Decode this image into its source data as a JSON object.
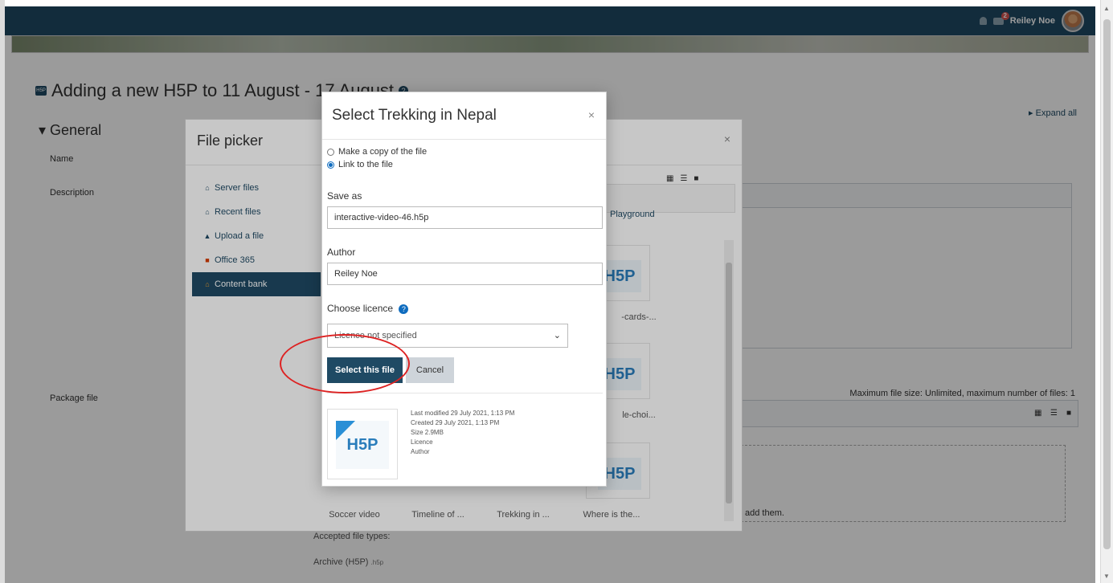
{
  "navbar": {
    "notifications_badge": "2",
    "user_name": "Reiley Noe"
  },
  "page": {
    "title": "Adding a new H5P to 11 August - 17 August",
    "expand_all": "▸ Expand all",
    "general_legend": "General",
    "labels": {
      "name": "Name",
      "description": "Description",
      "package_file": "Package file"
    },
    "max_file_size": "Maximum file size: Unlimited, maximum number of files: 1",
    "drop_text": "add them.",
    "accepted_types": "Accepted file types:",
    "archive": "Archive (H5P)",
    "archive_ext": ".h5p"
  },
  "file_picker": {
    "title": "File picker",
    "close": "×",
    "repositories": [
      {
        "label": "Server files",
        "icon": "server-icon"
      },
      {
        "label": "Recent files",
        "icon": "recent-icon"
      },
      {
        "label": "Upload a file",
        "icon": "upload-icon"
      },
      {
        "label": "Office 365",
        "icon": "office-icon"
      },
      {
        "label": "Content bank",
        "icon": "content-bank-icon"
      }
    ],
    "path_label": "Playground",
    "tiles": [
      {
        "label": "-cards-..."
      },
      {
        "label": "le-choi..."
      },
      {
        "label": ""
      }
    ],
    "bottom_labels": [
      "Soccer video",
      "Timeline of ...",
      "Trekking in ...",
      "Where is the..."
    ]
  },
  "select_dialog": {
    "title": "Select Trekking in Nepal",
    "close": "×",
    "options": {
      "copy": "Make a copy of the file",
      "link": "Link to the file"
    },
    "selected_option": "link",
    "save_as_label": "Save as",
    "save_as_value": "interactive-video-46.h5p",
    "author_label": "Author",
    "author_value": "Reiley Noe",
    "licence_label": "Choose licence",
    "licence_value": "Licence not specified",
    "select_button": "Select this file",
    "cancel_button": "Cancel",
    "meta": {
      "last_modified": "Last modified 29 July 2021, 1:13 PM",
      "created": "Created 29 July 2021, 1:13 PM",
      "size": "Size 2.9MB",
      "licence": "Licence",
      "author": "Author"
    }
  },
  "colors": {
    "navbar": "#1f4a64",
    "primary": "#1f4a64",
    "annotation": "#dd2222"
  }
}
